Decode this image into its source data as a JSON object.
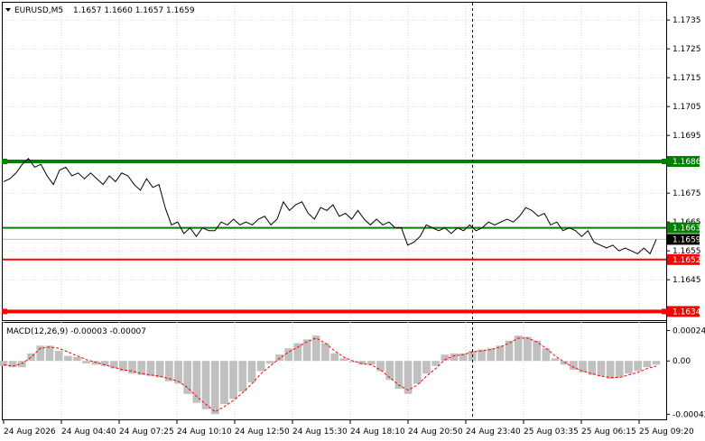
{
  "header": {
    "symbol_label": "EURUSD,M5",
    "ohlc": "1.1657 1.1660 1.1657 1.1659"
  },
  "macd": {
    "label": "MACD(12,26,9) -0.00003 -0.00007",
    "axis_ticks": [
      "0.00024",
      "0.00",
      "-0.00042"
    ]
  },
  "colors": {
    "green_level": "#008000",
    "red_level": "#ff0000",
    "price_line": "#000000",
    "macd_hist": "#c0c0c0",
    "macd_signal": "#ff0000",
    "current_price_tag": "#000000"
  },
  "chart_data": {
    "type": "line",
    "price_axis": {
      "ticks": [
        "1.1735",
        "1.1725",
        "1.1715",
        "1.1705",
        "1.1695",
        "1.1675",
        "1.1665",
        "1.1655",
        "1.1645"
      ],
      "ylim": [
        1.1631,
        1.1741
      ]
    },
    "time_axis": {
      "ticks": [
        "24 Aug 2026",
        "24 Aug 04:40",
        "24 Aug 07:25",
        "24 Aug 10:10",
        "24 Aug 12:50",
        "24 Aug 15:30",
        "24 Aug 18:10",
        "24 Aug 20:50",
        "24 Aug 23:40",
        "25 Aug 03:35",
        "25 Aug 06:15",
        "25 Aug 09:20"
      ]
    },
    "levels": [
      {
        "value": "1.1686",
        "price": 1.1686,
        "color": "#008000",
        "width": "thick"
      },
      {
        "value": "1.1663",
        "price": 1.1663,
        "color": "#008000",
        "width": "thin"
      },
      {
        "value": "1.1652",
        "price": 1.1652,
        "color": "#ff0000",
        "width": "thin"
      },
      {
        "value": "1.1634",
        "price": 1.1634,
        "color": "#ff0000",
        "width": "thick"
      }
    ],
    "current_price": {
      "value": "1.1659",
      "price": 1.1659
    },
    "price_series": [
      1.1679,
      1.168,
      1.1682,
      1.1685,
      1.1687,
      1.1684,
      1.1685,
      1.1681,
      1.1678,
      1.1683,
      1.1684,
      1.1681,
      1.1682,
      1.168,
      1.1682,
      1.168,
      1.1678,
      1.1681,
      1.1679,
      1.1682,
      1.1681,
      1.1678,
      1.1676,
      1.168,
      1.1677,
      1.1678,
      1.167,
      1.1664,
      1.1665,
      1.1661,
      1.1663,
      1.166,
      1.1663,
      1.1662,
      1.1662,
      1.1665,
      1.1664,
      1.1666,
      1.1664,
      1.1665,
      1.1664,
      1.1666,
      1.1667,
      1.1664,
      1.1666,
      1.1672,
      1.1669,
      1.1671,
      1.1672,
      1.1668,
      1.1666,
      1.167,
      1.1669,
      1.1671,
      1.1667,
      1.1668,
      1.1666,
      1.1669,
      1.1666,
      1.1664,
      1.1666,
      1.1664,
      1.1665,
      1.1663,
      1.1663,
      1.1657,
      1.1658,
      1.166,
      1.1664,
      1.1663,
      1.1662,
      1.1663,
      1.1661,
      1.1663,
      1.1662,
      1.1664,
      1.1662,
      1.1663,
      1.1665,
      1.1664,
      1.1665,
      1.1666,
      1.1665,
      1.1667,
      1.167,
      1.1669,
      1.1667,
      1.1668,
      1.1664,
      1.1665,
      1.1662,
      1.1663,
      1.1662,
      1.166,
      1.1662,
      1.1658,
      1.1657,
      1.1656,
      1.1657,
      1.1655,
      1.1656,
      1.1655,
      1.1654,
      1.1656,
      1.1654,
      1.1659
    ],
    "macd_ylim": [
      -0.00046,
      0.0003
    ],
    "macd_hist": [
      -4e-05,
      -5e-05,
      -5e-05,
      6e-05,
      0.00012,
      0.00012,
      8e-05,
      4e-05,
      3e-05,
      -2e-05,
      -3e-05,
      -4e-05,
      -6e-05,
      -8e-05,
      -0.0001,
      -0.00011,
      -0.00012,
      -0.00013,
      -0.00016,
      -0.00018,
      -0.00026,
      -0.00033,
      -0.00038,
      -0.00042,
      -0.00034,
      -0.0003,
      -0.00024,
      -0.00017,
      -8e-05,
      -2e-05,
      5e-05,
      0.0001,
      0.00014,
      0.00017,
      0.0002,
      0.00014,
      6e-05,
      2e-05,
      -1e-05,
      -3e-05,
      -3e-05,
      -8e-05,
      -0.00015,
      -0.00022,
      -0.00026,
      -0.00018,
      -0.0001,
      -4e-05,
      5e-05,
      6e-05,
      6e-05,
      8e-05,
      9e-05,
      0.0001,
      0.00012,
      0.00016,
      0.0002,
      0.00019,
      0.00016,
      0.0001,
      2e-05,
      -3e-05,
      -7e-05,
      -9e-05,
      -0.00011,
      -0.00012,
      -0.00014,
      -0.00013,
      -0.0001,
      -8e-05,
      -5e-05,
      -3e-05
    ],
    "macd_signal": [
      -3e-05,
      -4e-05,
      -2e-05,
      3e-05,
      0.0001,
      0.00011,
      0.0001,
      7e-05,
      4e-05,
      1e-05,
      -1e-05,
      -3e-05,
      -5e-05,
      -7e-05,
      -8e-05,
      -0.0001,
      -0.00011,
      -0.00012,
      -0.00014,
      -0.00016,
      -0.00021,
      -0.00028,
      -0.00034,
      -0.0004,
      -0.00036,
      -0.00031,
      -0.00025,
      -0.00018,
      -0.0001,
      -4e-05,
      2e-05,
      7e-05,
      0.00011,
      0.00015,
      0.00018,
      0.00014,
      8e-05,
      3e-05,
      0.0,
      -2e-05,
      -3e-05,
      -7e-05,
      -0.00013,
      -0.00019,
      -0.00023,
      -0.00019,
      -0.00012,
      -6e-05,
      1e-05,
      4e-05,
      5e-05,
      7e-05,
      8e-05,
      9e-05,
      0.00011,
      0.00014,
      0.00018,
      0.00018,
      0.00015,
      0.0001,
      4e-05,
      -1e-05,
      -5e-05,
      -8e-05,
      -0.0001,
      -0.00012,
      -0.00013,
      -0.00013,
      -0.00011,
      -9e-05,
      -6e-05,
      -4e-05
    ]
  }
}
